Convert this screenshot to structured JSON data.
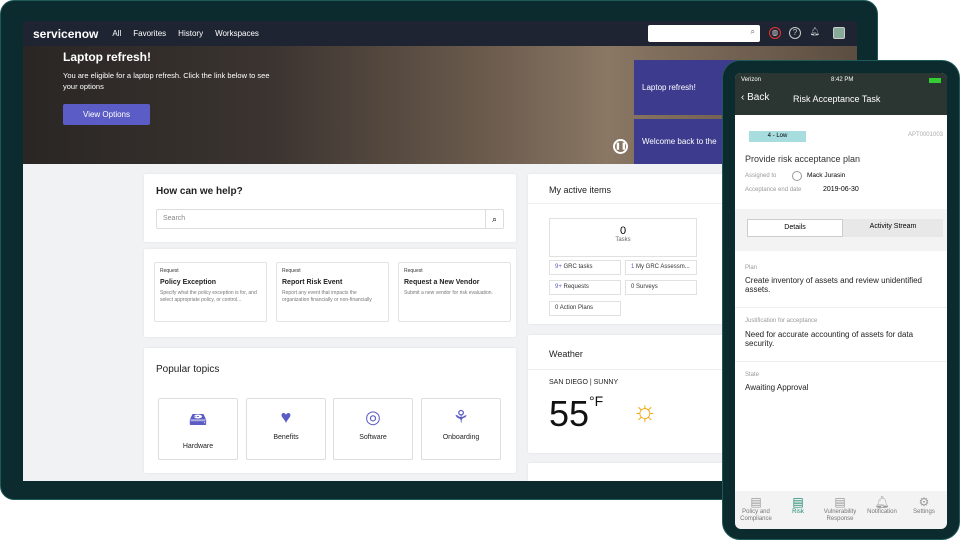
{
  "nav": {
    "logo": "servicenow",
    "links": [
      "All",
      "Favorites",
      "History",
      "Workspaces"
    ]
  },
  "hero": {
    "title": "Laptop refresh!",
    "text": "You are eligible for a laptop refresh. Click the link below to see your options",
    "button": "View Options",
    "slides": [
      "Laptop refresh!",
      "Welcome back to the"
    ]
  },
  "help": {
    "title": "How can we help?",
    "placeholder": "Search"
  },
  "requests": [
    {
      "type": "Request",
      "name": "Policy Exception",
      "desc": "Specify what the policy exception is for, and select appropriate policy, or control..."
    },
    {
      "type": "Request",
      "name": "Report Risk Event",
      "desc": "Report any event that impacts the organization financially or non-financially"
    },
    {
      "type": "Request",
      "name": "Request a New Vendor",
      "desc": "Submit a new vendor for risk evaluation."
    }
  ],
  "popular": {
    "title": "Popular topics",
    "topics": [
      "Hardware",
      "Benefits",
      "Software",
      "Onboarding"
    ]
  },
  "active": {
    "title": "My active items",
    "tasks_count": "0",
    "tasks_label": "Tasks",
    "chips": [
      {
        "n": "9+",
        "l": "GRC tasks"
      },
      {
        "n": "1",
        "l": "My GRC Assessm..."
      },
      {
        "n": "9+",
        "l": "Requests"
      },
      {
        "n": "0",
        "l": "Surveys"
      },
      {
        "n": "0",
        "l": "Action Plans"
      }
    ]
  },
  "weather": {
    "title": "Weather",
    "location": "SAN DIEGO | SUNNY",
    "temp": "55",
    "unit": "°F"
  },
  "phone": {
    "carrier": "Verizon",
    "time": "8:42 PM",
    "back": "Back",
    "title": "Risk Acceptance Task",
    "priority": "4 - Low",
    "number": "APT0001003",
    "task": "Provide risk acceptance plan",
    "assigned_label": "Assigned to",
    "assigned": "Mack Jurasin",
    "end_label": "Acceptance end date",
    "end": "2019-06-30",
    "tabs": [
      "Details",
      "Activity Stream"
    ],
    "fields": [
      {
        "l": "Plan",
        "v": "Create inventory of assets and review unidentified assets."
      },
      {
        "l": "Justification for acceptance",
        "v": "Need for accurate accounting of assets for data security."
      },
      {
        "l": "State",
        "v": "Awaiting Approval"
      }
    ],
    "bottom": [
      "Policy and Compliance",
      "Risk",
      "Vulnerability Response",
      "Notification",
      "Settings"
    ],
    "colors": {
      "accent": "#1f8a70",
      "priority": "#a8dde0"
    }
  }
}
